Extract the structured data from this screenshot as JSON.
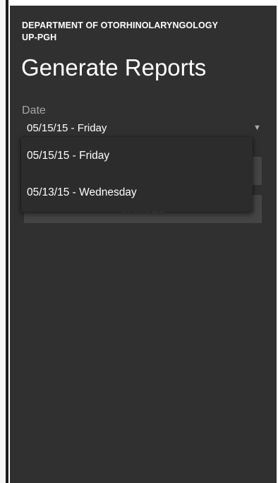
{
  "header": {
    "department_line1": "DEPARTMENT OF OTORHINOLARYNGOLOGY",
    "department_line2": "UP-PGH",
    "title": "Generate Reports"
  },
  "form": {
    "date_label": "Date",
    "selected_date": "05/15/15 - Friday",
    "caret_icon": "dropdown-caret-icon"
  },
  "buttons": {
    "generate_label": "",
    "cancel_label": "CANCEL"
  },
  "dropdown": {
    "options": [
      {
        "label": "05/15/15 - Friday"
      },
      {
        "label": "05/13/15 - Wednesday"
      }
    ]
  },
  "colors": {
    "background": "#303030",
    "muted_label": "#a6a6a6",
    "button": "#454545",
    "menu": "#2c2c2c"
  }
}
